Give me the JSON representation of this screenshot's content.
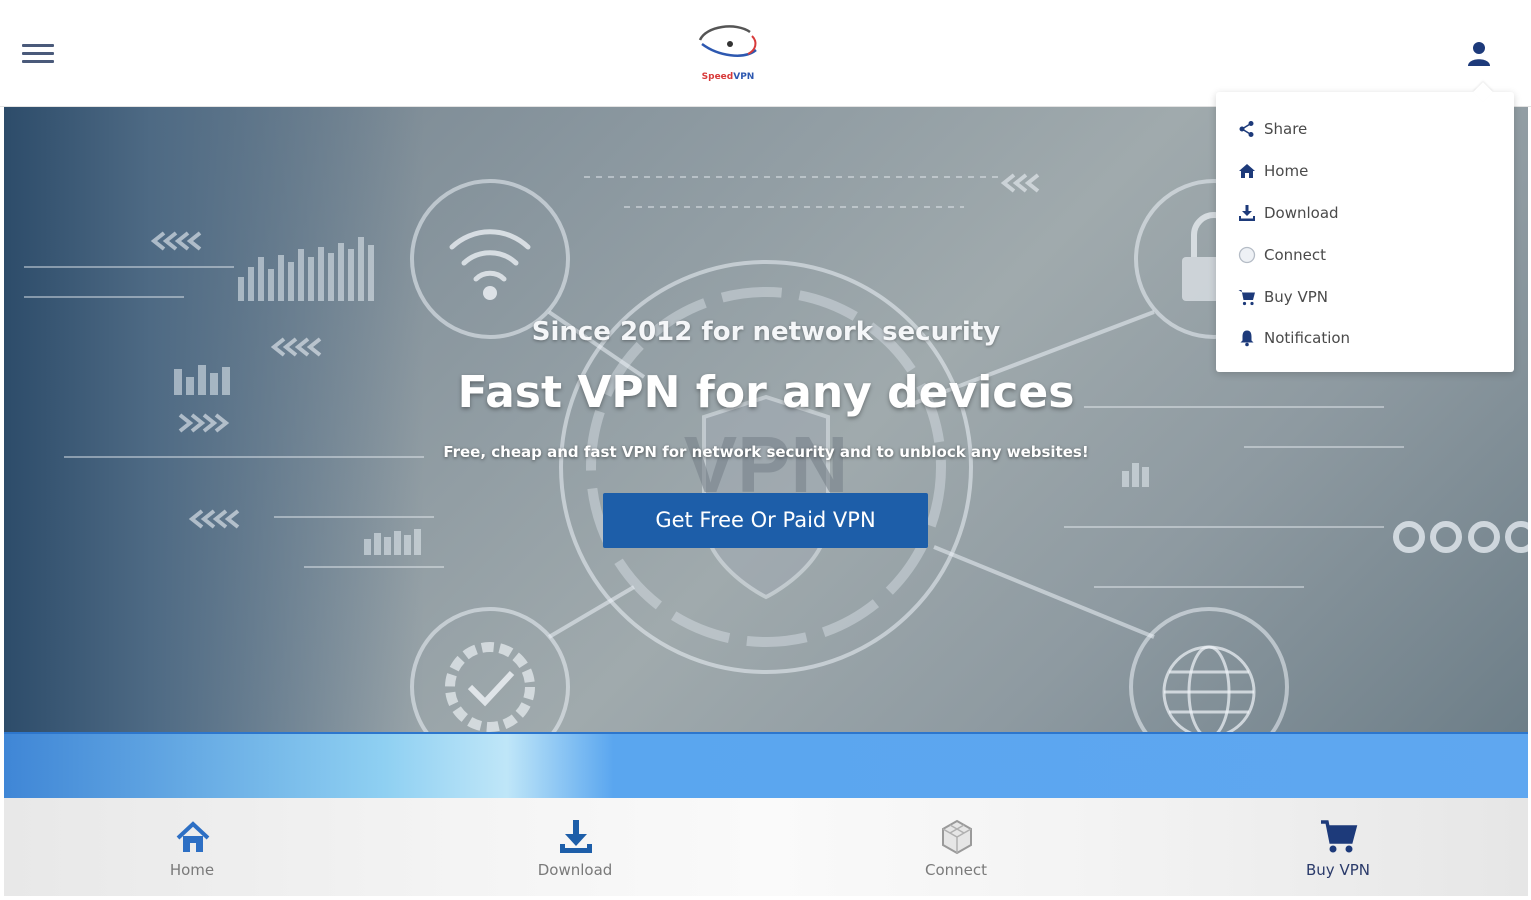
{
  "header": {
    "logo_text_a": "Speed",
    "logo_text_b": "VPN"
  },
  "hero": {
    "since": "Since 2012 for network security",
    "headline": "Fast VPN for any devices",
    "subline": "Free, cheap and fast VPN for network security and to unblock any websites!",
    "cta_label": "Get Free Or Paid VPN",
    "bg_vpn_text": "VPN"
  },
  "dropdown": {
    "items": [
      {
        "label": "Share",
        "icon": "share-icon"
      },
      {
        "label": "Home",
        "icon": "home-icon"
      },
      {
        "label": "Download",
        "icon": "download-icon"
      },
      {
        "label": "Connect",
        "icon": "connect-icon"
      },
      {
        "label": "Buy VPN",
        "icon": "cart-icon"
      },
      {
        "label": "Notification",
        "icon": "bell-icon"
      }
    ]
  },
  "bottom_nav": {
    "items": [
      {
        "label": "Home",
        "icon": "home-icon"
      },
      {
        "label": "Download",
        "icon": "download-icon"
      },
      {
        "label": "Connect",
        "icon": "connect-icon"
      },
      {
        "label": "Buy VPN",
        "icon": "cart-icon"
      }
    ],
    "active": "Buy VPN"
  },
  "colors": {
    "primary": "#1d5ea9",
    "nav_icon": "#2d6fc4",
    "dark_icon": "#1d3a7a"
  }
}
